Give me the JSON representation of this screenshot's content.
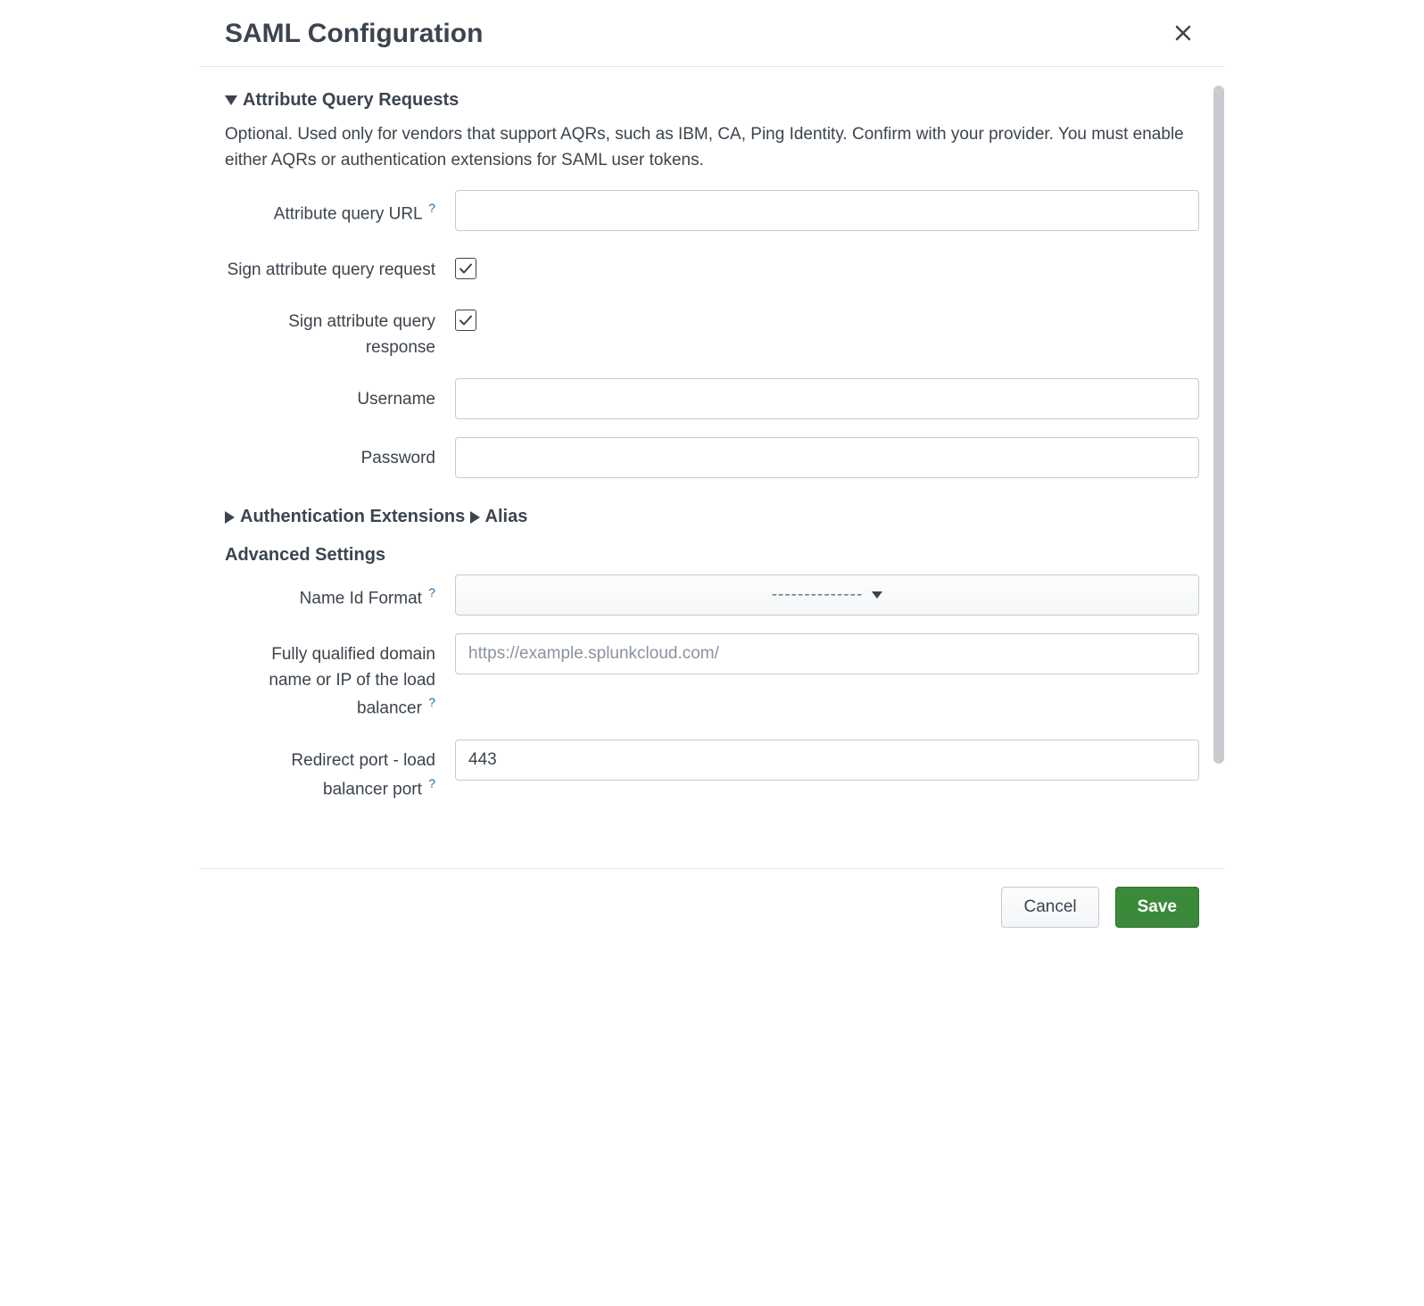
{
  "modal": {
    "title": "SAML Configuration"
  },
  "sections": {
    "aqr": {
      "title": "Attribute Query Requests",
      "description": "Optional. Used only for vendors that support AQRs, such as IBM, CA, Ping Identity. Confirm with your provider. You must enable either AQRs or authentication extensions for SAML user tokens.",
      "url_label": "Attribute query URL",
      "url_value": "",
      "sign_request_label": "Sign attribute query request",
      "sign_request_checked": true,
      "sign_response_label": "Sign attribute query response",
      "sign_response_checked": true,
      "username_label": "Username",
      "username_value": "",
      "password_label": "Password",
      "password_value": ""
    },
    "auth_ext": {
      "title": "Authentication Extensions"
    },
    "alias": {
      "title": "Alias"
    },
    "advanced": {
      "title": "Advanced Settings",
      "name_id_label": "Name Id Format",
      "name_id_value": "--------------",
      "fqdn_label": "Fully qualified domain name or IP of the load balancer",
      "fqdn_placeholder": "https://example.splunkcloud.com/",
      "fqdn_value": "",
      "redirect_port_label": "Redirect port - load balancer port",
      "redirect_port_value": "443"
    }
  },
  "footer": {
    "cancel": "Cancel",
    "save": "Save"
  },
  "help_icon": "?"
}
